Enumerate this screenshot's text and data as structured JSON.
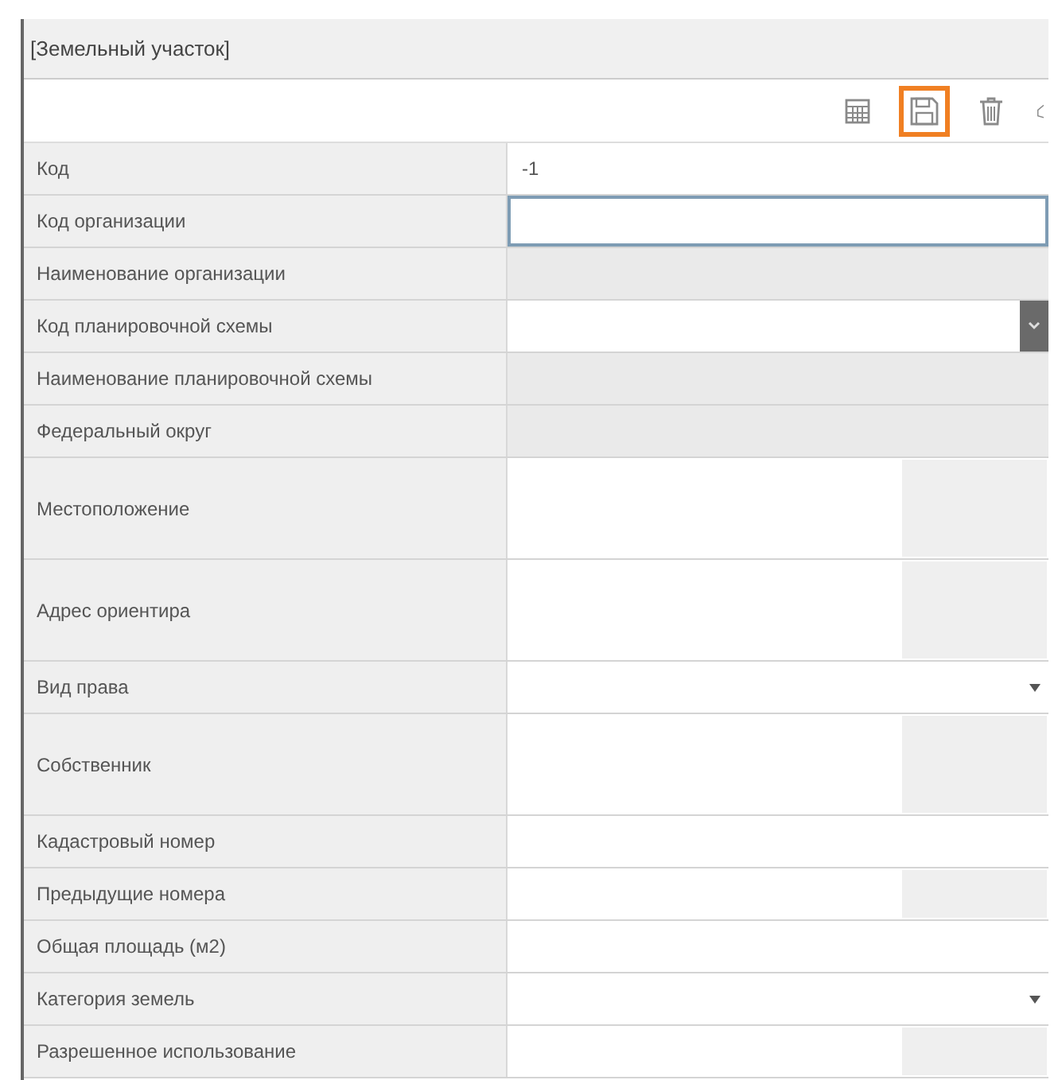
{
  "window": {
    "title": "[Земельный участок]"
  },
  "toolbar": [
    {
      "kind": "table",
      "highlighted": false
    },
    {
      "kind": "save",
      "highlighted": true
    },
    {
      "kind": "trash",
      "highlighted": false
    },
    {
      "kind": "cut",
      "highlighted": false
    }
  ],
  "rows": [
    {
      "label": "Код",
      "kind": "text",
      "value": "-1",
      "focused": false
    },
    {
      "label": "Код организации",
      "kind": "text",
      "focused": true
    },
    {
      "label": "Наименование организации",
      "kind": "readonly",
      "focused": false
    },
    {
      "label": "Код планировочной схемы",
      "kind": "lookup",
      "focused": false
    },
    {
      "label": "Наименование планировочной схемы",
      "kind": "readonly",
      "focused": false
    },
    {
      "label": "Федеральный округ",
      "kind": "readonly",
      "focused": false
    },
    {
      "label": "Местоположение",
      "kind": "tall",
      "focused": false
    },
    {
      "label": "Адрес ориентира",
      "kind": "tall",
      "focused": false
    },
    {
      "label": "Вид права",
      "kind": "select",
      "focused": false
    },
    {
      "label": "Собственник",
      "kind": "tall",
      "focused": false
    },
    {
      "label": "Кадастровый номер",
      "kind": "text",
      "focused": false
    },
    {
      "label": "Предыдущие номера",
      "kind": "short",
      "focused": false
    },
    {
      "label": "Общая площадь (м2)",
      "kind": "text",
      "focused": false
    },
    {
      "label": "Категория земель",
      "kind": "select",
      "focused": false
    },
    {
      "label": "Разрешенное использование",
      "kind": "short",
      "focused": false
    }
  ]
}
